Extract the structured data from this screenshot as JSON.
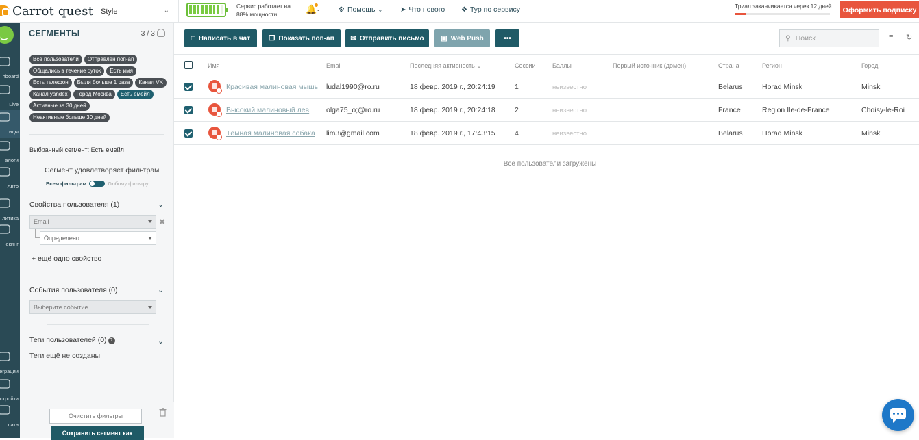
{
  "app": {
    "logo_text": "Carrot quest",
    "project": "Style",
    "service_status_line1": "Сервис работает на",
    "service_status_line2": "88% мощности",
    "battery_level": 0.88,
    "help": "Помощь",
    "whats_new": "Что нового",
    "tour": "Тур по сервису",
    "trial_text": "Триал заканчивается через 12 дней",
    "trial_progress": 0.12,
    "subscribe": "Оформить подписку",
    "accent": "#e8553d",
    "primary": "#1f5a66"
  },
  "rail": {
    "items": [
      {
        "label": "hboard",
        "icon": "dashboard-icon"
      },
      {
        "label": "Live",
        "icon": "live-icon"
      },
      {
        "label": "иды",
        "icon": "users-icon"
      },
      {
        "label": "алоги",
        "icon": "dialogs-icon"
      },
      {
        "label": "Авто",
        "icon": "auto-icon"
      },
      {
        "label": "литика",
        "icon": "analytics-icon"
      },
      {
        "label": "екинг",
        "icon": "tracking-icon"
      },
      {
        "label": "еграции",
        "icon": "integrations-icon"
      },
      {
        "label": "стройки",
        "icon": "settings-icon"
      },
      {
        "label": "лата",
        "icon": "payment-icon"
      }
    ]
  },
  "segments": {
    "title": "СЕГМЕНТЫ",
    "count": "3 / 3",
    "tags": [
      {
        "label": "Все пользователи",
        "selected": false
      },
      {
        "label": "Отправлен поп-ап",
        "selected": false
      },
      {
        "label": "Общались в течение суток",
        "selected": false
      },
      {
        "label": "Есть имя",
        "selected": false
      },
      {
        "label": "Есть телефон",
        "selected": false
      },
      {
        "label": "Были больше 1 раза",
        "selected": false
      },
      {
        "label": "Канал VK",
        "selected": false
      },
      {
        "label": "Канал yandex",
        "selected": false
      },
      {
        "label": "Город Москва",
        "selected": false
      },
      {
        "label": "Есть емейл",
        "selected": true
      },
      {
        "label": "Активные за 30 дней",
        "selected": false
      },
      {
        "label": "Неактивные больше 30 дней",
        "selected": false
      }
    ],
    "selected_label": "Выбранный сегмент:",
    "selected_value": "Есть емейл",
    "filter_match": "Сегмент удовлетворяет фильтрам",
    "all_filters": "Всем фильтрам",
    "any_filter": "Любому фильтру",
    "user_props_title": "Свойства пользователя (1)",
    "prop_field": "Email",
    "prop_condition": "Определено",
    "add_prop": "+ ещё одно свойство",
    "events_title": "События пользователя (0)",
    "event_placeholder": "Выберите событие",
    "tags_title": "Теги пользователей (0)",
    "no_tags": "Теги ещё не созданы",
    "clear": "Очистить фильтры",
    "save": "Сохранить сегмент как"
  },
  "toolbar": {
    "chat": "Написать в чат",
    "popup": "Показать поп-ап",
    "email": "Отправить письмо",
    "webpush": "Web Push",
    "more": "•••",
    "search_placeholder": "Поиск"
  },
  "table": {
    "columns": [
      "Имя",
      "Email",
      "Последняя активность",
      "Сессии",
      "Баллы",
      "Первый источник (домен)",
      "Страна",
      "Регион",
      "Город"
    ],
    "rows": [
      {
        "name": "Красивая малиновая мышь",
        "email": "ludal1990@ro.ru",
        "last": "18 февр. 2019 г., 20:24:19",
        "sessions": "1",
        "score": "неизвестно",
        "source": "",
        "country": "Belarus",
        "region": "Horad Minsk",
        "city": "Minsk",
        "checked": true
      },
      {
        "name": "Высокий малиновый лев",
        "email": "olga75_o;@ro.ru",
        "last": "18 февр. 2019 г., 20:24:18",
        "sessions": "2",
        "score": "неизвестно",
        "source": "",
        "country": "France",
        "region": "Region Ile-de-France",
        "city": "Choisy-le-Roi",
        "checked": true
      },
      {
        "name": "Тёмная малиновая собака",
        "email": "lim3@gmail.com",
        "last": "18 февр. 2019 г., 17:43:15",
        "sessions": "4",
        "score": "неизвестно",
        "source": "",
        "country": "Belarus",
        "region": "Horad Minsk",
        "city": "Minsk",
        "checked": true
      }
    ],
    "all_loaded": "Все пользователи загружены"
  }
}
